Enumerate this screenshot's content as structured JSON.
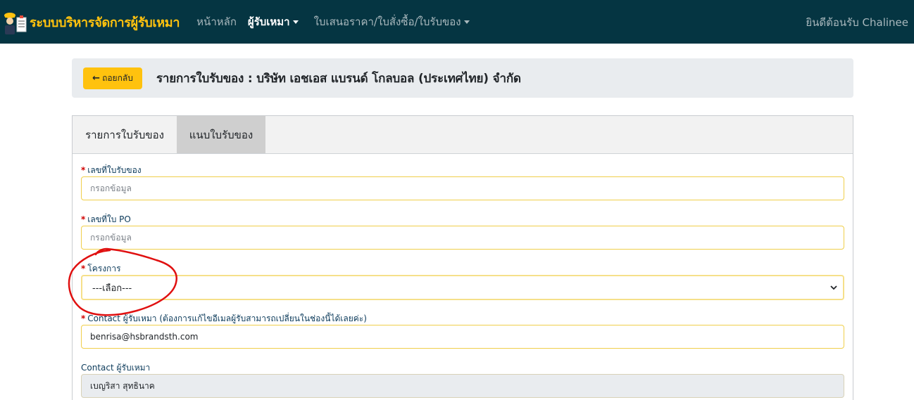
{
  "navbar": {
    "brand_title": "ระบบบริหารจัดการผู้รับเหมา",
    "items": [
      {
        "label": "หน้าหลัก"
      },
      {
        "label": "ผู้รับเหมา"
      },
      {
        "label": "ใบเสนอราคา/ใบสั่งซื้อ/ใบรับของ"
      }
    ],
    "welcome": "ยินดีต้อนรับ Chalinee"
  },
  "header": {
    "back_label": "ถอยกลับ",
    "title": "รายการใบรับของ : บริษัท เอชเอส แบรนด์ โกลบอล (ประเทศไทย) จำกัด"
  },
  "tabs": [
    {
      "label": "รายการใบรับของ"
    },
    {
      "label": "แนบใบรับของ"
    }
  ],
  "form": {
    "receipt_no": {
      "required_mark": "*",
      "label": "เลขที่ใบรับของ",
      "placeholder": "กรอกข้อมูล",
      "value": ""
    },
    "po_no": {
      "required_mark": "*",
      "label": "เลขที่ใบ PO",
      "placeholder": "กรอกข้อมูล",
      "value": ""
    },
    "project": {
      "required_mark": "*",
      "label": "โครงการ",
      "selected": "---เลือก---"
    },
    "contact_email": {
      "required_mark": "*",
      "label": "Contact ผู้รับเหมา (ต้องการแก้ไขอีเมลผู้รับสามารถเปลี่ยนในช่องนี้ได้เลยค่ะ)",
      "value": "benrisa@hsbrandsth.com"
    },
    "contact_name": {
      "label": "Contact ผู้รับเหมา",
      "value": "เบญริสา สุทธินาค"
    }
  },
  "colors": {
    "navbar_bg": "#053542",
    "brand": "#ffc20e",
    "accent_button": "#ffc20e",
    "annotation": "#e01010"
  }
}
